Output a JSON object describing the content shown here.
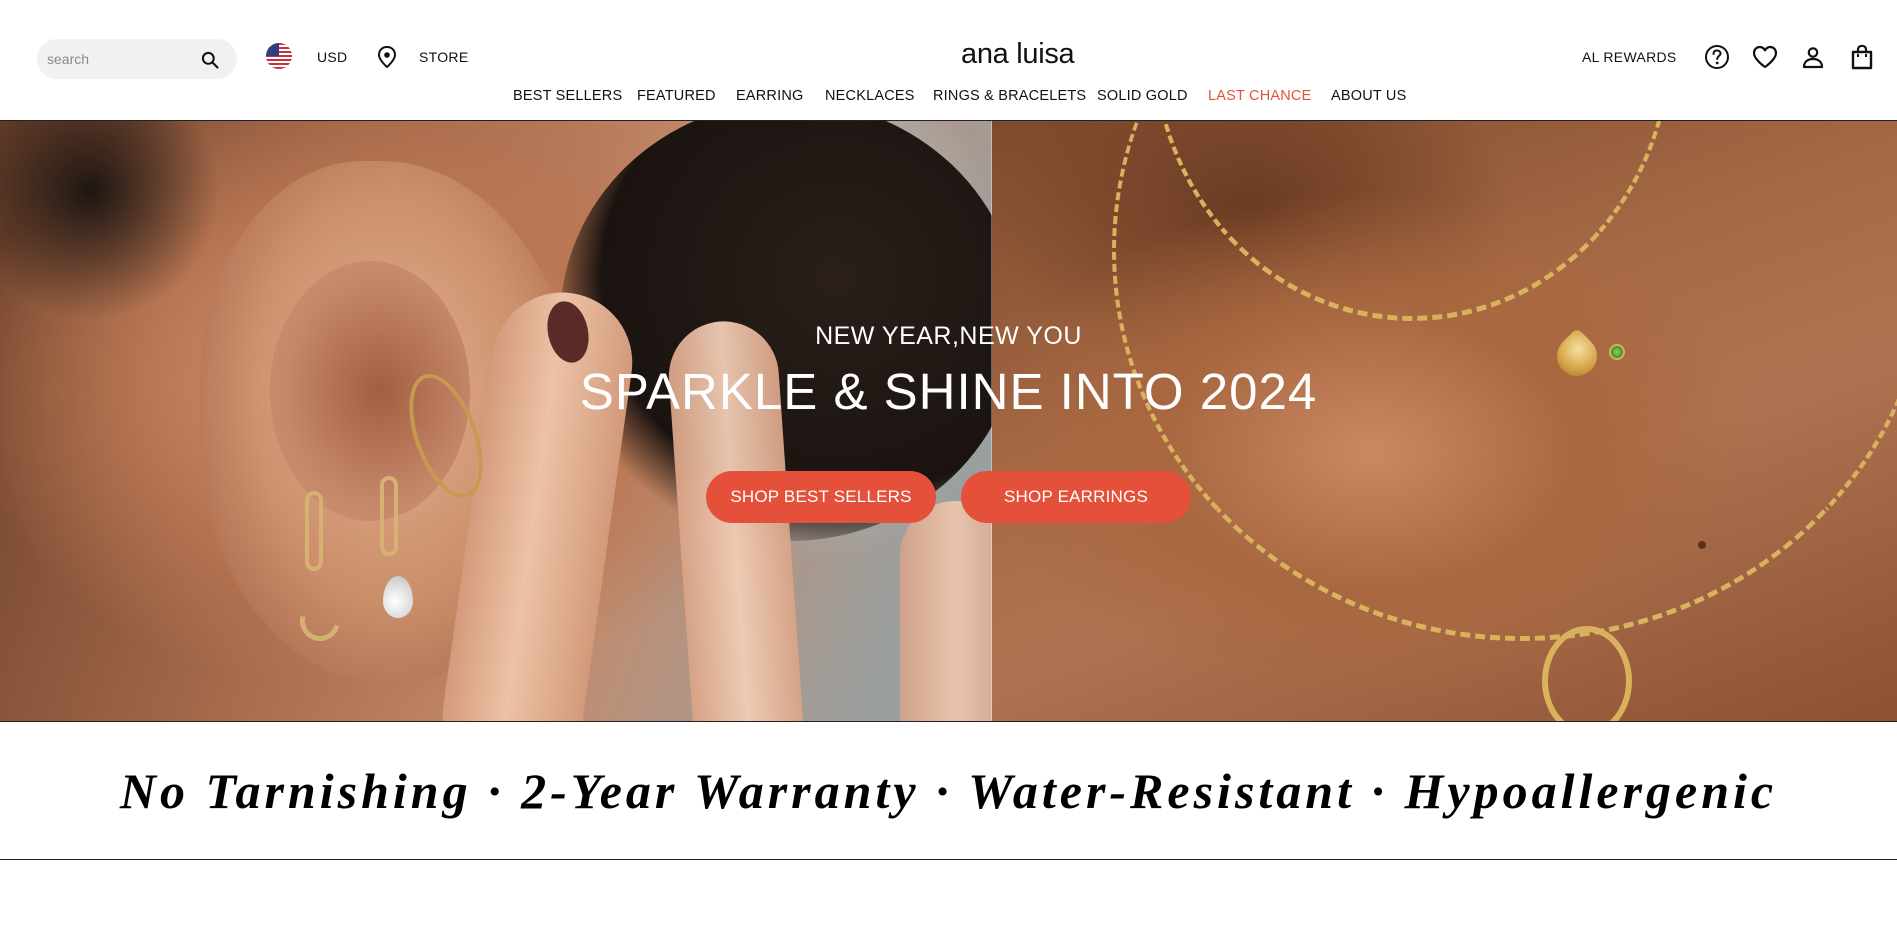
{
  "header": {
    "search": {
      "placeholder": "search"
    },
    "currency": "USD",
    "store_label": "STORE",
    "logo": "ana luisa",
    "rewards_label": "AL REWARDS",
    "icons": [
      "help-icon",
      "wishlist-heart-icon",
      "account-icon",
      "cart-bag-icon"
    ]
  },
  "nav": {
    "items": [
      {
        "label": "BEST SELLERS"
      },
      {
        "label": "FEATURED"
      },
      {
        "label": "EARRING"
      },
      {
        "label": "NECKLACES"
      },
      {
        "label": "RINGS & BRACELETS"
      },
      {
        "label": "SOLID GOLD"
      },
      {
        "label": "LAST CHANCE",
        "color": "#e0533c"
      },
      {
        "label": "ABOUT US"
      }
    ]
  },
  "hero": {
    "subtitle": "NEW YEAR,NEW YOU",
    "title": "SPARKLE & SHINE INTO 2024",
    "buttons": [
      {
        "label": "SHOP BEST SELLERS"
      },
      {
        "label": "SHOP EARRINGS"
      }
    ],
    "button_color": "#e4503a"
  },
  "features": {
    "text": "No Tarnishing · 2-Year Warranty · Water-Resistant · Hypoallergenic"
  }
}
